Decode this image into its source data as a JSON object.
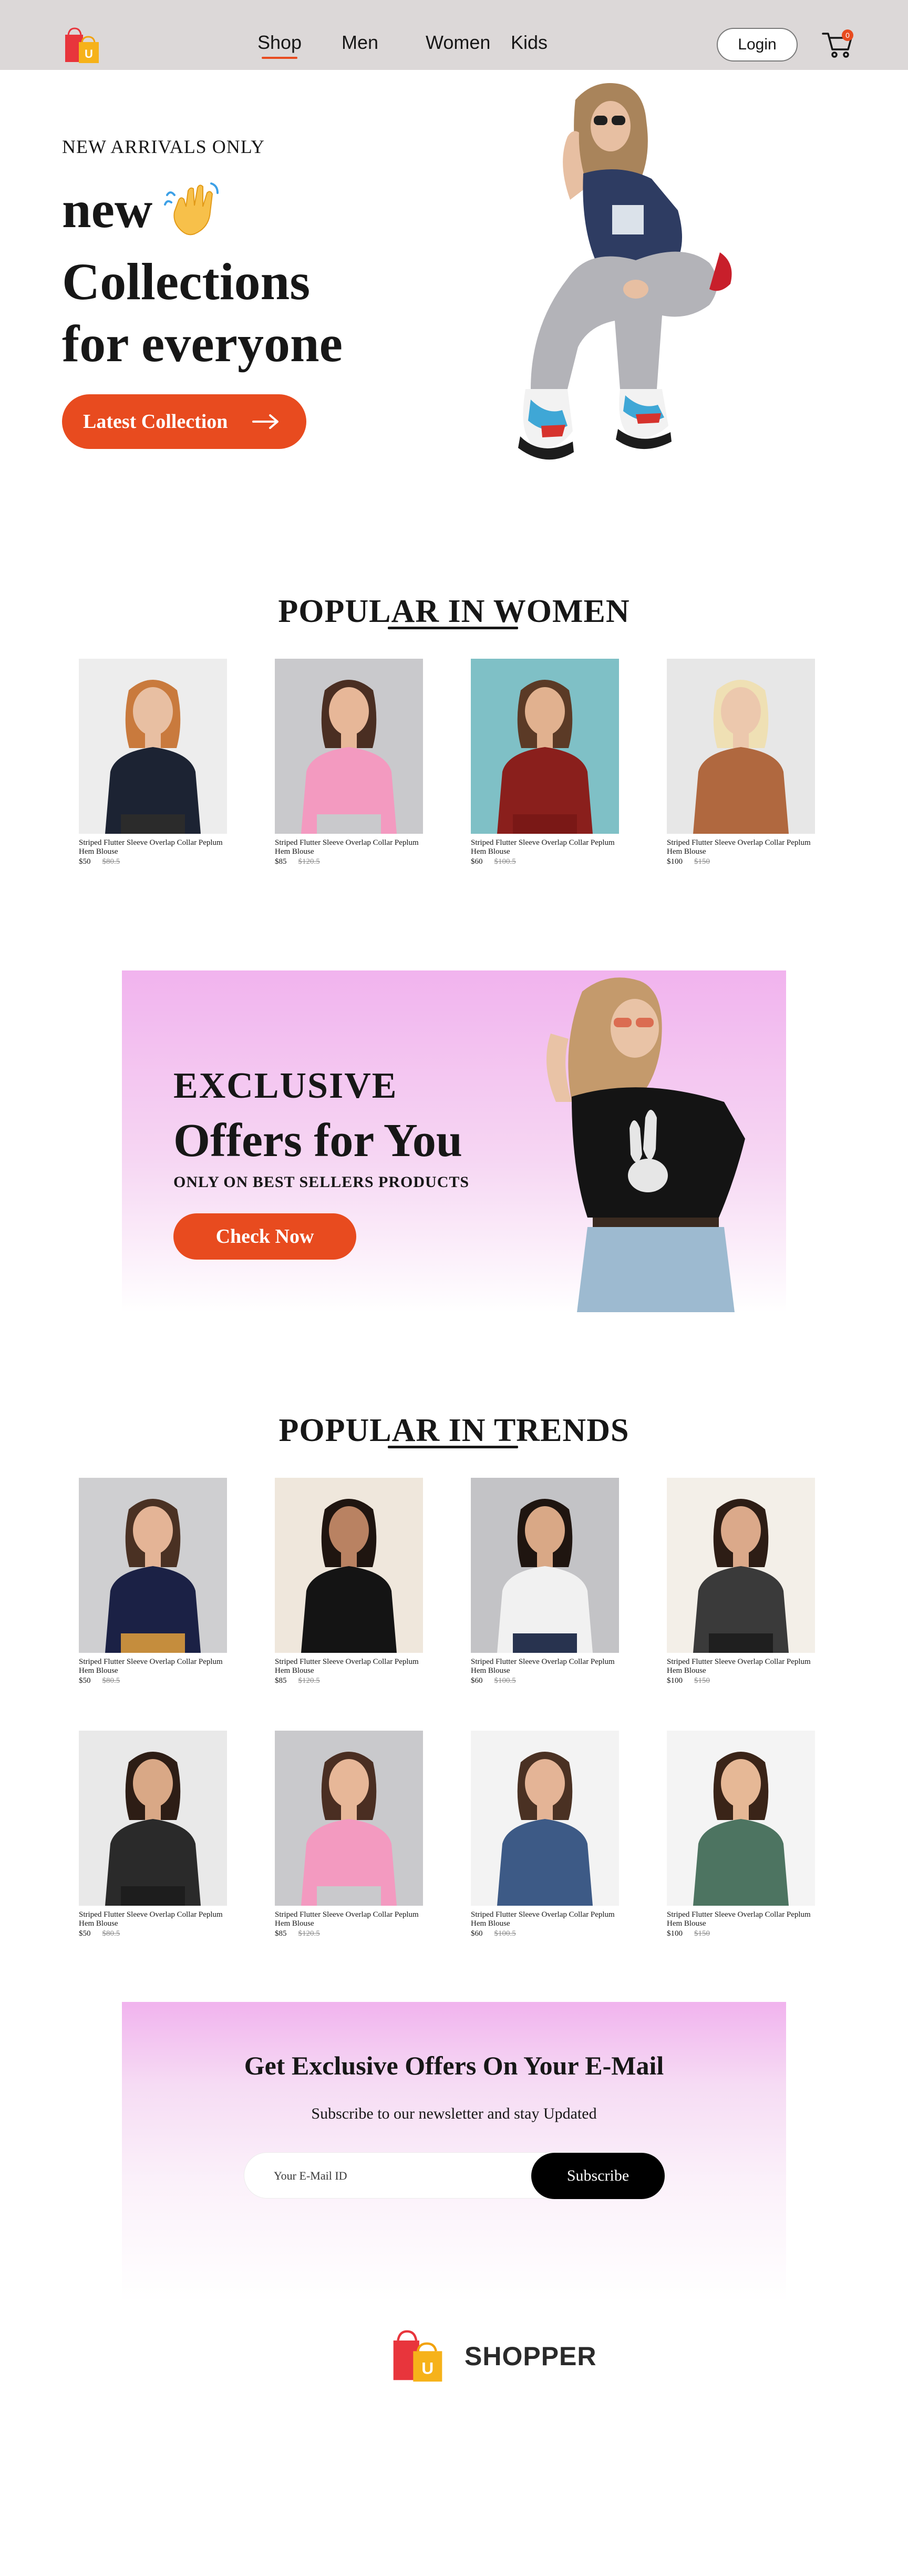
{
  "nav": {
    "links": [
      {
        "label": "Shop",
        "active": true
      },
      {
        "label": "Men",
        "active": false
      },
      {
        "label": "Women",
        "active": false
      },
      {
        "label": "Kids",
        "active": false
      }
    ],
    "login_label": "Login",
    "cart_count": "0",
    "logo_letter": "U"
  },
  "hero": {
    "eyebrow": "NEW ARRIVALS ONLY",
    "title_line1": "new",
    "title_line2": "Collections",
    "title_line3": "for everyone",
    "cta_label": "Latest Collection"
  },
  "popular_women": {
    "title": "POPULAR IN WOMEN",
    "products": [
      {
        "name": "Striped Flutter Sleeve Overlap Collar Peplum Hem Blouse",
        "new_price": "$50",
        "old_price": "$80.5",
        "palette": {
          "bg": "#ededed",
          "top": "#1c2333",
          "skin": "#e8bfa2",
          "hair": "#c97a3d",
          "bottom": "#2b2b2b"
        }
      },
      {
        "name": "Striped Flutter Sleeve Overlap Collar Peplum Hem Blouse",
        "new_price": "$85",
        "old_price": "$120.5",
        "palette": {
          "bg": "#c9c9cc",
          "top": "#f39ac0",
          "skin": "#e7b798",
          "hair": "#4a2e22",
          "bottom": "#c9c9cc"
        }
      },
      {
        "name": "Striped Flutter Sleeve Overlap Collar Peplum Hem Blouse",
        "new_price": "$60",
        "old_price": "$100.5",
        "palette": {
          "bg": "#7fc0c6",
          "top": "#8a1f1c",
          "skin": "#e1b18f",
          "hair": "#5b3a26",
          "bottom": "#7a1816"
        }
      },
      {
        "name": "Striped Flutter Sleeve Overlap Collar Peplum Hem Blouse",
        "new_price": "$100",
        "old_price": "$150",
        "palette": {
          "bg": "#e7e7e7",
          "top": "#b0683f",
          "skin": "#ecc8ad",
          "hair": "#efe0b4",
          "bottom": "#b0683f"
        }
      }
    ]
  },
  "offer": {
    "eyebrow": "EXCLUSIVE",
    "title": "Offers for You",
    "subtitle": "ONLY ON BEST SELLERS PRODUCTS",
    "cta_label": "Check Now"
  },
  "popular_trends": {
    "title": "POPULAR IN TRENDS",
    "products": [
      {
        "name": "Striped Flutter Sleeve Overlap Collar Peplum Hem Blouse",
        "new_price": "$50",
        "old_price": "$80.5",
        "palette": {
          "bg": "#cfcfd1",
          "top": "#1b2145",
          "skin": "#e4b496",
          "hair": "#4a3123",
          "bottom": "#c58d3d"
        }
      },
      {
        "name": "Striped Flutter Sleeve Overlap Collar Peplum Hem Blouse",
        "new_price": "$85",
        "old_price": "$120.5",
        "palette": {
          "bg": "#efe7dc",
          "top": "#141414",
          "skin": "#b98262",
          "hair": "#1f1510",
          "bottom": "#141414"
        }
      },
      {
        "name": "Striped Flutter Sleeve Overlap Collar Peplum Hem Blouse",
        "new_price": "$60",
        "old_price": "$100.5",
        "palette": {
          "bg": "#c3c3c6",
          "top": "#f1f1f1",
          "skin": "#d9a886",
          "hair": "#1f1510",
          "bottom": "#28334f"
        }
      },
      {
        "name": "Striped Flutter Sleeve Overlap Collar Peplum Hem Blouse",
        "new_price": "$100",
        "old_price": "$150",
        "palette": {
          "bg": "#f3efe8",
          "top": "#3a3a3a",
          "skin": "#dba98a",
          "hair": "#2d1d15",
          "bottom": "#1f1f1f"
        }
      },
      {
        "name": "Striped Flutter Sleeve Overlap Collar Peplum Hem Blouse",
        "new_price": "$50",
        "old_price": "$80.5",
        "palette": {
          "bg": "#e9e9e9",
          "top": "#2a2a2a",
          "skin": "#d9a886",
          "hair": "#2d1d15",
          "bottom": "#1d1d1d"
        }
      },
      {
        "name": "Striped Flutter Sleeve Overlap Collar Peplum Hem Blouse",
        "new_price": "$85",
        "old_price": "$120.5",
        "palette": {
          "bg": "#c9c9cc",
          "top": "#f39ac0",
          "skin": "#e7b798",
          "hair": "#4a2e22",
          "bottom": "#c9c9cc"
        }
      },
      {
        "name": "Striped Flutter Sleeve Overlap Collar Peplum Hem Blouse",
        "new_price": "$60",
        "old_price": "$100.5",
        "palette": {
          "bg": "#f3f3f3",
          "top": "#3d5a86",
          "skin": "#e4b496",
          "hair": "#4a3123",
          "bottom": "#3d5a86"
        }
      },
      {
        "name": "Striped Flutter Sleeve Overlap Collar Peplum Hem Blouse",
        "new_price": "$100",
        "old_price": "$150",
        "palette": {
          "bg": "#f4f4f4",
          "top": "#4d7461",
          "skin": "#e6b896",
          "hair": "#3a2418",
          "bottom": "#4d7461"
        }
      }
    ]
  },
  "newsletter": {
    "title": "Get Exclusive Offers On Your E-Mail",
    "subtitle": "Subscribe to our newsletter and stay Updated",
    "placeholder": "Your E-Mail ID",
    "button_label": "Subscribe"
  },
  "footer": {
    "brand": "SHOPPER",
    "logo_letter": "U"
  },
  "colors": {
    "accent": "#e84b1f",
    "nav_bg": "#dcd8d8",
    "pink": "#f1b3ee"
  }
}
